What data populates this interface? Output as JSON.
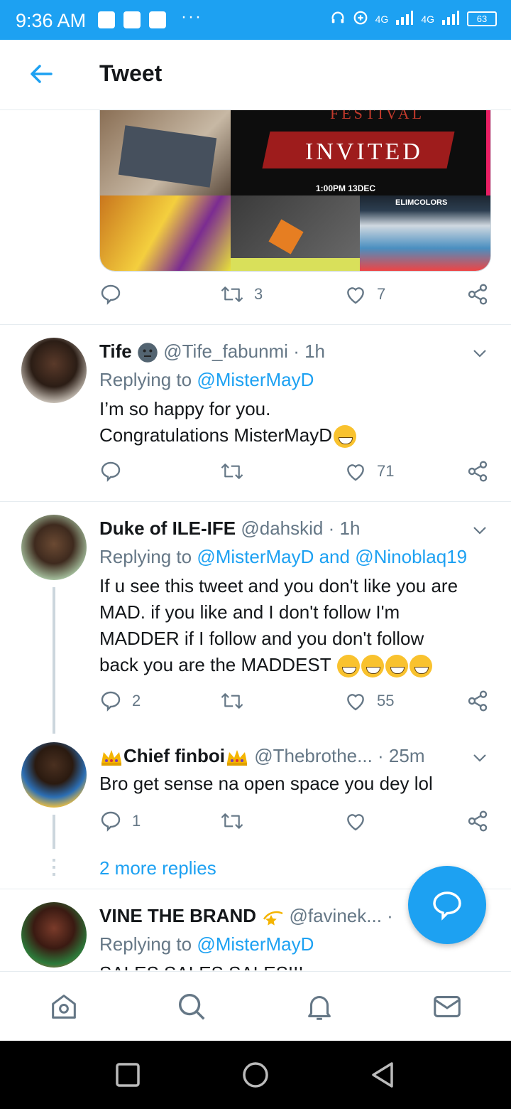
{
  "status_bar": {
    "time": "9:36 AM",
    "network": "4G",
    "battery": "63"
  },
  "header": {
    "title": "Tweet"
  },
  "media": {
    "festival_text": "FESTIVAL",
    "invited_text": "INVITED",
    "time_text": "1:00PM  13DEC",
    "brand_text": "ELIMCOLORS"
  },
  "main_tweet_actions": {
    "retweets": "3",
    "likes": "7"
  },
  "replies": [
    {
      "name": "Tife",
      "handle": "@Tife_fabunmi",
      "time": "· 1h",
      "replying_prefix": "Replying to",
      "replying_to": "@MisterMayD",
      "lines": [
        "I’m so happy for you.",
        "Congratulations MisterMayD"
      ],
      "replies": "",
      "retweets": "",
      "likes": "71"
    },
    {
      "name": "Duke of ILE-IFE",
      "handle": "@dahskid",
      "time": "· 1h",
      "replying_prefix": "Replying to",
      "replying_to": "@MisterMayD and @Ninoblaq19",
      "lines": [
        "If u see this tweet and you don't like you are",
        "MAD. if you like and I don't follow I'm",
        "MADDER if I follow and you don't follow",
        "back you are the MADDEST"
      ],
      "replies": "2",
      "retweets": "",
      "likes": "55"
    },
    {
      "name": "Chief finboi",
      "handle": "@Thebrothe...",
      "time": "· 25m",
      "lines": [
        "Bro get sense na open space you dey lol"
      ],
      "replies": "1",
      "retweets": "",
      "likes": ""
    },
    {
      "name": "VINE THE BRAND",
      "handle": "@favinek...",
      "time": "·",
      "replying_prefix": "Replying to",
      "replying_to": "@MisterMayD",
      "lines": [
        "SALES SALES SALES!!!"
      ]
    }
  ],
  "more_replies": "2 more replies",
  "colors": {
    "accent": "#1da1f2",
    "text": "#14171a",
    "secondary": "#657786"
  }
}
